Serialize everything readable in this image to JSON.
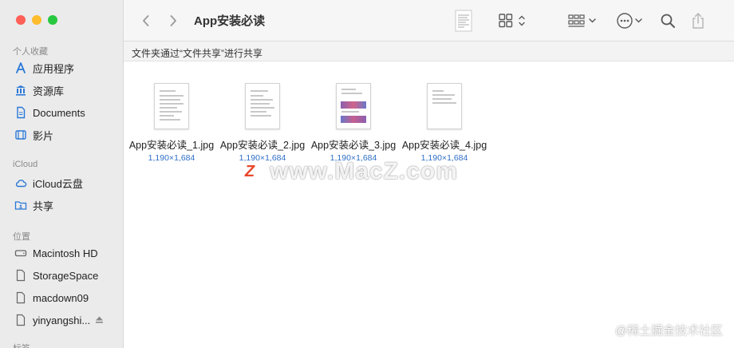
{
  "window": {
    "title": "App安装必读"
  },
  "sidebar": {
    "favorites_title": "个人收藏",
    "favorites": [
      {
        "label": "应用程序",
        "icon": "applications-icon"
      },
      {
        "label": "资源库",
        "icon": "library-icon"
      },
      {
        "label": "Documents",
        "icon": "document-icon"
      },
      {
        "label": "影片",
        "icon": "movie-icon"
      }
    ],
    "icloud_title": "iCloud",
    "icloud": [
      {
        "label": "iCloud云盘",
        "icon": "cloud-icon"
      },
      {
        "label": "共享",
        "icon": "shared-folder-icon"
      }
    ],
    "locations_title": "位置",
    "locations": [
      {
        "label": "Macintosh HD",
        "icon": "disk-icon"
      },
      {
        "label": "StorageSpace",
        "icon": "file-icon"
      },
      {
        "label": "macdown09",
        "icon": "file-icon"
      },
      {
        "label": "yinyangshi...",
        "icon": "file-icon"
      }
    ],
    "tags_title": "标签"
  },
  "pathbar": {
    "text": "文件夹通过“文件共享”进行共享"
  },
  "files": [
    {
      "name": "App安装必读_1.jpg",
      "dims": "1,190×1,684"
    },
    {
      "name": "App安装必读_2.jpg",
      "dims": "1,190×1,684"
    },
    {
      "name": "App安装必读_3.jpg",
      "dims": "1,190×1,684"
    },
    {
      "name": "App安装必读_4.jpg",
      "dims": "1,190×1,684"
    }
  ],
  "watermark": {
    "text": "www.MacZ.com",
    "logo_letter": "Z",
    "corner": "@稀土掘金技术社区"
  },
  "colors": {
    "sidebar_bg": "#ebebeb",
    "accent_blue": "#2f6fc7",
    "close": "#fe5f57",
    "minimize": "#febc2e",
    "zoom": "#28c840"
  }
}
